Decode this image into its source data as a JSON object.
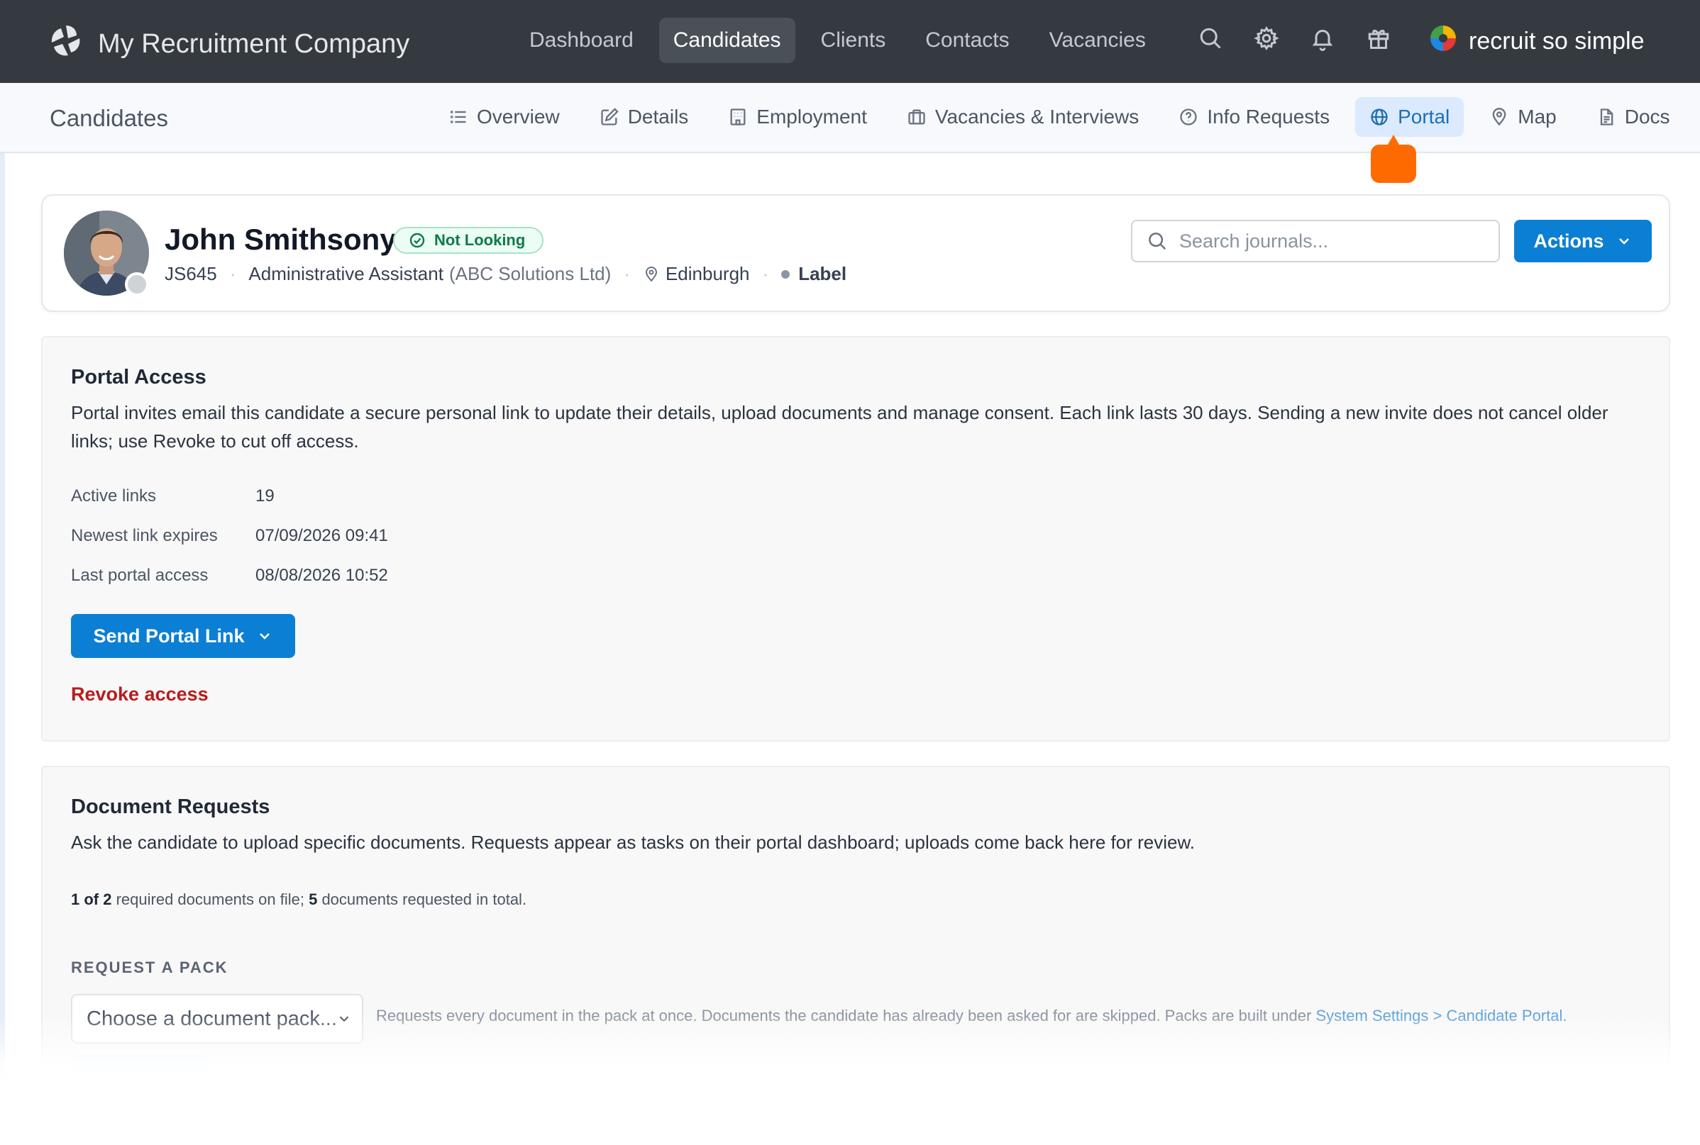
{
  "app": {
    "company_name": "My Recruitment Company",
    "brand_product": "recruit so simple"
  },
  "nav": {
    "items": [
      {
        "label": "Dashboard",
        "active": false
      },
      {
        "label": "Candidates",
        "active": true
      },
      {
        "label": "Clients",
        "active": false
      },
      {
        "label": "Contacts",
        "active": false
      },
      {
        "label": "Vacancies",
        "active": false
      }
    ],
    "icons": [
      "search-icon",
      "gear-icon",
      "bell-icon",
      "gift-icon"
    ]
  },
  "subnav": {
    "title": "Candidates",
    "tabs": [
      {
        "label": "Overview",
        "icon": "list-icon",
        "active": false
      },
      {
        "label": "Details",
        "icon": "edit-icon",
        "active": false
      },
      {
        "label": "Employment",
        "icon": "building-icon",
        "active": false
      },
      {
        "label": "Vacancies & Interviews",
        "icon": "briefcase-icon",
        "active": false
      },
      {
        "label": "Info Requests",
        "icon": "question-icon",
        "active": false
      },
      {
        "label": "Portal",
        "icon": "globe-icon",
        "active": true
      },
      {
        "label": "Map",
        "icon": "map-pin-icon",
        "active": false
      },
      {
        "label": "Docs",
        "icon": "document-icon",
        "active": false
      }
    ]
  },
  "candidate": {
    "name": "John Smithsony",
    "status": "Not Looking",
    "ref": "JS645",
    "job_title": "Administrative Assistant",
    "company": "(ABC Solutions Ltd)",
    "location": "Edinburgh",
    "label": "Label"
  },
  "search": {
    "placeholder": "Search journals..."
  },
  "actions": {
    "label": "Actions"
  },
  "portal_access": {
    "title": "Portal Access",
    "description": "Portal invites email this candidate a secure personal link to update their details, upload documents and manage consent. Each link lasts 30 days. Sending a new invite does not cancel older links; use Revoke to cut off access.",
    "rows": [
      {
        "label": "Active links",
        "value": "19"
      },
      {
        "label": "Newest link expires",
        "value": "07/09/2026 09:41"
      },
      {
        "label": "Last portal access",
        "value": "08/08/2026 10:52"
      }
    ],
    "send_label": "Send Portal Link",
    "revoke_label": "Revoke access"
  },
  "document_requests": {
    "title": "Document Requests",
    "description": "Ask the candidate to upload specific documents. Requests appear as tasks on their portal dashboard; uploads come back here for review.",
    "summary": {
      "on_file": "1 of 2",
      "on_file_text": " required documents on file; ",
      "requested": "5",
      "requested_text": " documents requested in total."
    },
    "pack_label": "REQUEST A PACK",
    "pack_placeholder": "Choose a document pack...",
    "pack_help": "Requests every document in the pack at once. Documents the candidate has already been asked for are skipped. Packs are built under ",
    "pack_help_link": "System Settings > Candidate Portal",
    "pack_help_end": "."
  },
  "colors": {
    "topbar": "#353a41",
    "primary": "#0b7fd4",
    "danger": "#b91c1c",
    "pointer": "#ff6a00",
    "success": "#0f7a4a"
  }
}
